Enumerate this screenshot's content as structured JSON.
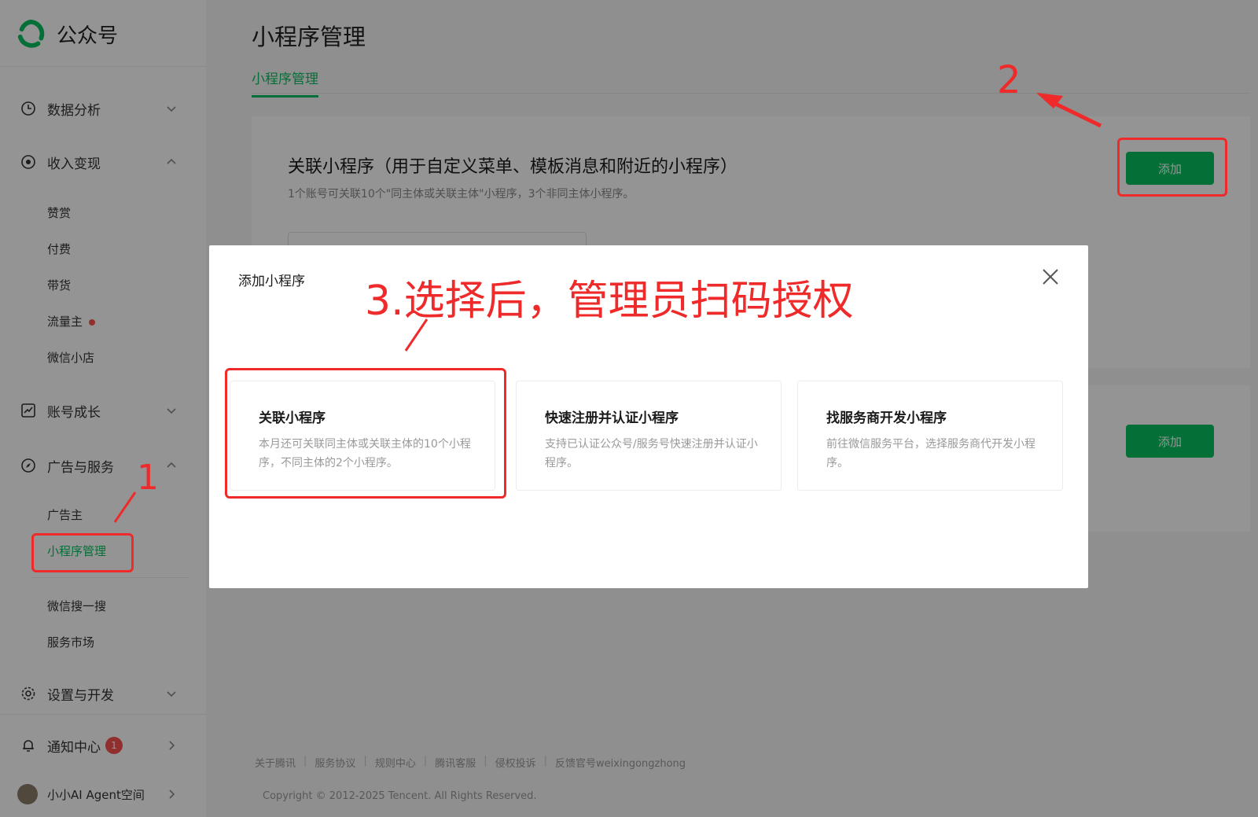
{
  "app": {
    "name": "公众号"
  },
  "sidebar": {
    "groups": {
      "data": "数据分析",
      "income": "收入变现",
      "growth": "账号成长",
      "ads": "广告与服务",
      "settings": "设置与开发",
      "notify": "通知中心",
      "account": "小小AI Agent空间"
    },
    "income_items": [
      "赞赏",
      "付费",
      "带货",
      "流量主",
      "微信小店"
    ],
    "ads_items": [
      "广告主",
      "小程序管理",
      "微信搜一搜",
      "服务市场"
    ],
    "notify_badge": "1"
  },
  "main": {
    "title": "小程序管理",
    "tab": "小程序管理",
    "panel_title": "关联小程序（用于自定义菜单、模板消息和附近的小程序）",
    "panel_desc": "1个账号可关联10个\"同主体或关联主体\"小程序，3个非同主体小程序。",
    "add_label": "添加",
    "add_label_2": "添加"
  },
  "footer": {
    "links": [
      "关于腾讯",
      "服务协议",
      "规则中心",
      "腾讯客服",
      "侵权投诉",
      "反馈官号weixingongzhong"
    ],
    "copyright": "Copyright © 2012-2025 Tencent. All Rights Reserved."
  },
  "dialog": {
    "title": "添加小程序",
    "options": [
      {
        "title": "关联小程序",
        "desc": "本月还可关联同主体或关联主体的10个小程序，不同主体的2个小程序。"
      },
      {
        "title": "快速注册并认证小程序",
        "desc": "支持已认证公众号/服务号快速注册并认证小程序。"
      },
      {
        "title": "找服务商开发小程序",
        "desc": "前往微信服务平台，选择服务商代开发小程序。"
      }
    ]
  },
  "annotations": {
    "step1": "1",
    "step2": "2",
    "step3": "3.选择后，管理员扫码授权"
  },
  "colors": {
    "brand_green": "#07c160",
    "annotation_red": "#ee2a2a",
    "badge_red": "#fa5151"
  },
  "icons": [
    "wechat-mp-logo-icon",
    "chart-clock-icon",
    "target-icon",
    "trend-chart-icon",
    "compass-icon",
    "gear-icon",
    "bell-icon",
    "chevron-down-icon",
    "chevron-up-icon",
    "chevron-right-icon",
    "close-icon"
  ]
}
